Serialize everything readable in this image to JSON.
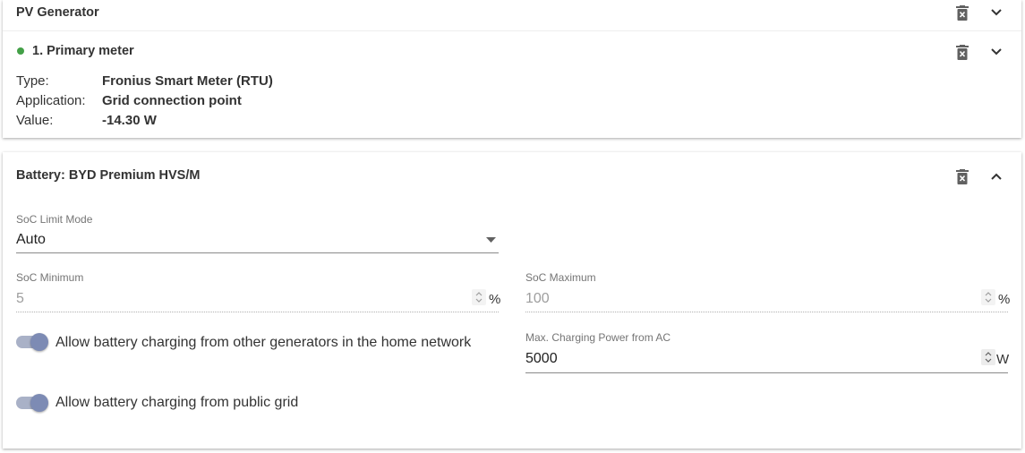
{
  "pv_card": {
    "title": "PV Generator",
    "meter": {
      "title": "1. Primary meter",
      "status_color": "#43a047",
      "rows": [
        {
          "label": "Type:",
          "value": "Fronius Smart Meter (RTU)"
        },
        {
          "label": "Application:",
          "value": "Grid connection point"
        },
        {
          "label": "Value:",
          "value": "-14.30 W"
        }
      ]
    }
  },
  "battery_card": {
    "title": "Battery: BYD Premium HVS/M",
    "soc_limit_mode": {
      "label": "SoC Limit Mode",
      "value": "Auto"
    },
    "soc_minimum": {
      "label": "SoC Minimum",
      "value": "5",
      "unit": "%"
    },
    "soc_maximum": {
      "label": "SoC Maximum",
      "value": "100",
      "unit": "%"
    },
    "max_charging_power": {
      "label": "Max. Charging Power from AC",
      "value": "5000",
      "unit": "W"
    },
    "toggle_generators": {
      "label": "Allow battery charging from other generators in the home network",
      "checked": true
    },
    "toggle_grid": {
      "label": "Allow battery charging from public grid",
      "checked": true
    }
  },
  "colors": {
    "toggle_track": "#a9b1c7",
    "toggle_knob": "#7d8bb4",
    "icon": "#616161"
  }
}
